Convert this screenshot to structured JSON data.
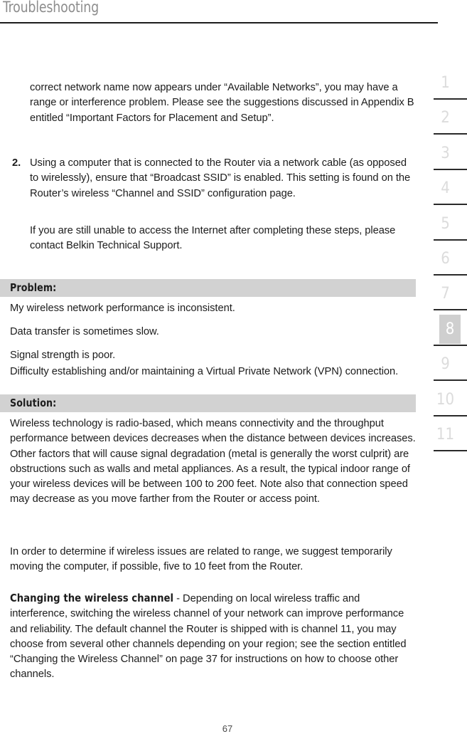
{
  "header": {
    "title": "Troubleshooting"
  },
  "body": {
    "paragraphs": [
      {
        "id": "p-continued",
        "text": "correct network name now appears under “Available Networks”, you may have a range or interference problem. Please see the suggestions discussed in Appendix B entitled “Important Factors for Placement and Setup”."
      },
      {
        "id": "p-step-2",
        "marker": "2.",
        "text": "Using a computer that is connected to the Router via a network cable (as opposed to wirelessly), ensure that “Broadcast SSID” is enabled. This setting is found on the Router’s wireless “Channel and SSID” configuration page."
      },
      {
        "id": "p-contact-support",
        "text": "If you are still unable to access the Internet after completing these steps, please contact Belkin Technical Support."
      }
    ],
    "problem": {
      "bar_label": "Problem:",
      "lines": [
        "My wireless network performance is inconsistent.",
        "Data transfer is sometimes slow.",
        "Signal strength is poor.",
        "Difficulty establishing and/or maintaining a Virtual Private Network (VPN) connection."
      ]
    },
    "solution": {
      "bar_label": "Solution:",
      "paragraph_1": "Wireless technology is radio-based, which means connectivity and the throughput performance between devices decreases when the distance between devices increases. Other factors that will cause signal degradation (metal is generally the worst culprit) are obstructions such as walls and metal appliances. As a result, the typical indoor range of your wireless devices will be between 100 to 200 feet. Note also that connection speed may decrease as you move farther from the Router or access point.",
      "paragraph_2": "In order to determine if wireless issues are related to range, we suggest temporarily moving the computer, if possible, five to 10 feet from the Router.",
      "paragraph_3_lead": "Changing the wireless channel",
      "paragraph_3_rest": " - Depending on local wireless traffic and interference, switching the wireless channel of your network can improve performance and reliability. The default channel the Router is shipped with is channel 11, you may choose from several other channels depending on your region; see the section entitled “Changing the Wireless Channel” on page 37 for instructions on how to choose other channels."
    }
  },
  "section_index": {
    "items": [
      {
        "label": "1",
        "active": false
      },
      {
        "label": "2",
        "active": false
      },
      {
        "label": "3",
        "active": false
      },
      {
        "label": "4",
        "active": false
      },
      {
        "label": "5",
        "active": false
      },
      {
        "label": "6",
        "active": false
      },
      {
        "label": "7",
        "active": false
      },
      {
        "label": "8",
        "active": true
      },
      {
        "label": "9",
        "active": false
      },
      {
        "label": "10",
        "active": false
      },
      {
        "label": "11",
        "active": false
      }
    ]
  },
  "footer": {
    "page_number": "67"
  },
  "colors": {
    "bar_gray": "#d2d2d2",
    "index_gray": "#dcdcdc",
    "index_active_bg": "#cfcfcf",
    "title_gray": "#8d8d8d",
    "text": "#1c1c1c"
  }
}
